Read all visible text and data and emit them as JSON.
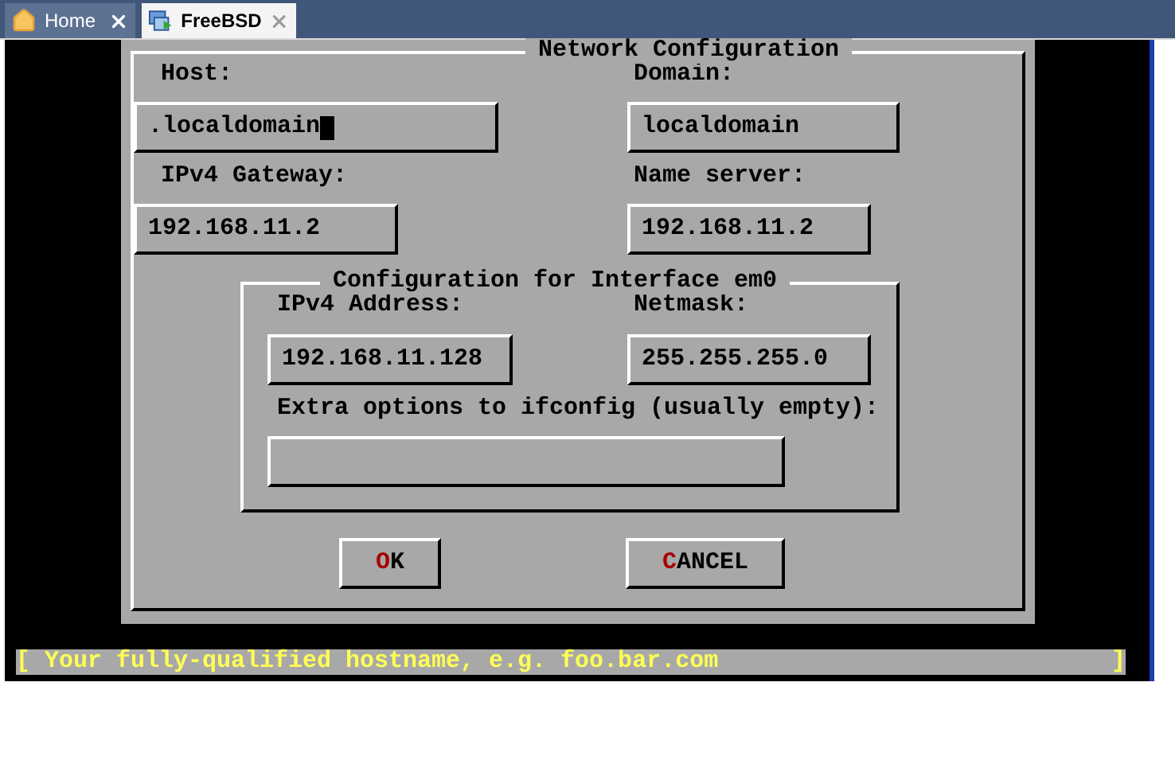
{
  "tabs": [
    {
      "label": "Home",
      "kind": "home",
      "selected": false
    },
    {
      "label": "FreeBSD",
      "kind": "vm",
      "selected": true
    }
  ],
  "dialog": {
    "title": "Network Configuration",
    "rows": [
      [
        {
          "label": "Host:",
          "value": ".localdomain",
          "focused": true
        },
        {
          "label": "Domain:",
          "value": "localdomain"
        }
      ],
      [
        {
          "label": "IPv4 Gateway:",
          "value": "192.168.11.2"
        },
        {
          "label": "Name server:",
          "value": "192.168.11.2"
        }
      ]
    ],
    "interface": {
      "title": "Configuration for Interface em0",
      "rows": [
        [
          {
            "label": "IPv4 Address:",
            "value": "192.168.11.128"
          },
          {
            "label": "Netmask:",
            "value": "255.255.255.0"
          }
        ]
      ],
      "extra": {
        "label": "Extra options to ifconfig (usually empty):"
      }
    },
    "buttons": [
      {
        "hotkey": "O",
        "rest": "K"
      },
      {
        "hotkey": "C",
        "rest": "ANCEL"
      }
    ]
  },
  "status_bar": {
    "open": "[",
    "text": "Your fully-qualified hostname, e.g. foo.bar.com",
    "close": "]"
  }
}
